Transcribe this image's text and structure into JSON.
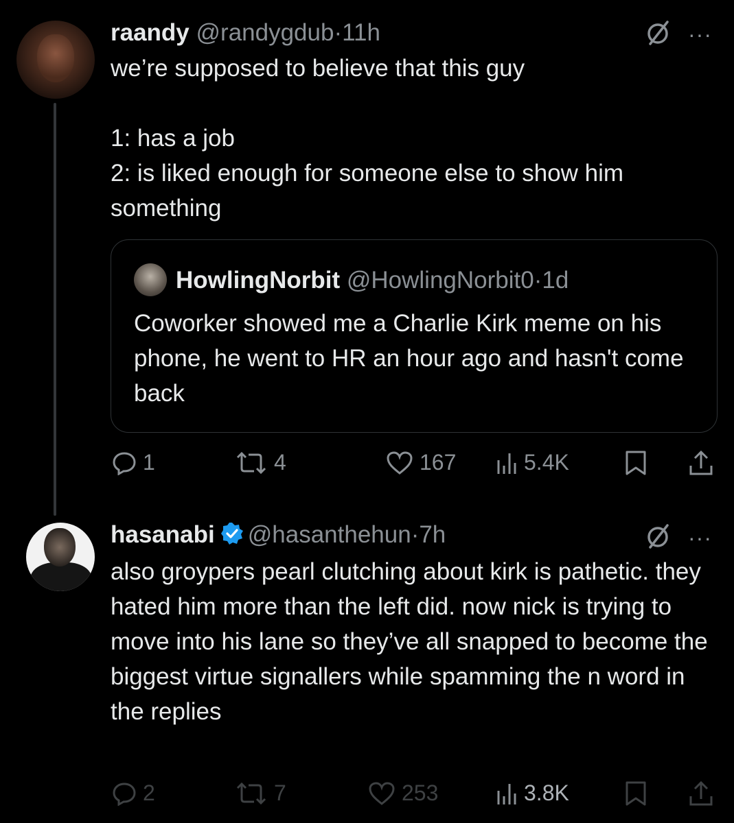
{
  "tweet1": {
    "display_name": "raandy",
    "handle": "@randygdub",
    "separator": "·",
    "time": "11h",
    "body": "we’re supposed to believe that this guy\n\n1: has a job\n2: is liked enough for someone else to show him something",
    "quote": {
      "display_name": "HowlingNorbit",
      "handle": "@HowlingNorbit0",
      "separator": "·",
      "time": "1d",
      "body": "Coworker showed me a Charlie Kirk meme on his phone, he went to HR an hour ago and hasn't come back"
    },
    "actions": {
      "replies": "1",
      "reposts": "4",
      "likes": "167",
      "views": "5.4K"
    }
  },
  "tweet2": {
    "display_name": "hasanabi",
    "verified": true,
    "handle": "@hasanthehun",
    "separator": "·",
    "time": "7h",
    "body": "also groypers pearl clutching about kirk is pathetic. they hated him more than the left did. now nick is trying to move into his lane so they’ve all snapped to become the biggest virtue signallers while spamming the n word in the replies",
    "actions": {
      "replies": "2",
      "reposts": "7",
      "likes": "253",
      "views": "3.8K"
    }
  },
  "more_menu_glyph": "···",
  "icons": [
    "grok-icon",
    "more-icon",
    "reply-icon",
    "repost-icon",
    "like-icon",
    "views-icon",
    "bookmark-icon",
    "share-icon",
    "verified-badge-icon"
  ],
  "colors": {
    "background": "#000000",
    "text": "#e7e9ea",
    "muted": "#8b9095",
    "verified": "#1d9bf0"
  }
}
